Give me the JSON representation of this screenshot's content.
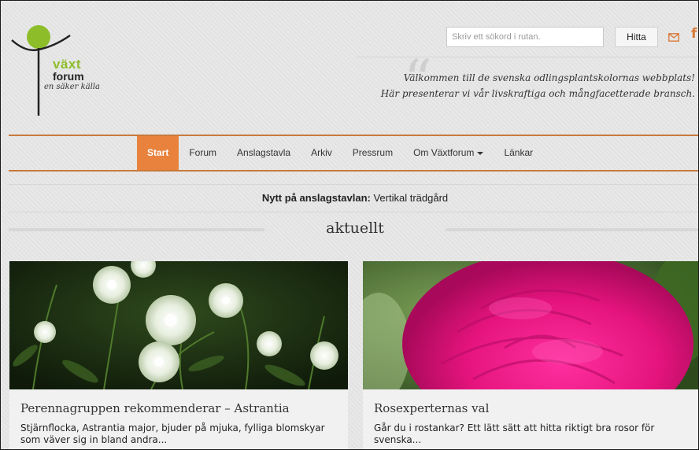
{
  "logo": {
    "word1": "växt",
    "word2": "forum",
    "tagline": "en säker källa"
  },
  "search": {
    "placeholder": "Skriv ett sökord i rutan.",
    "button_label": "Hitta"
  },
  "header": {
    "quote_mark": "“",
    "welcome_line1": "Välkommen till de svenska odlingsplantskolornas webbplats!",
    "welcome_line2": "Här presenterar vi vår livskraftiga och mångfacetterade bransch.",
    "social_facebook": "f"
  },
  "nav": {
    "items": [
      {
        "label": "Start"
      },
      {
        "label": "Forum"
      },
      {
        "label": "Anslagstavla"
      },
      {
        "label": "Arkiv"
      },
      {
        "label": "Pressrum"
      },
      {
        "label": "Om Växtforum"
      },
      {
        "label": "Länkar"
      }
    ]
  },
  "news": {
    "prefix": "Nytt på anslagstavlan:",
    "text": " Vertikal trädgård"
  },
  "section": {
    "title": "aktuellt"
  },
  "cards": [
    {
      "title": "Perennagruppen rekommenderar – Astrantia",
      "excerpt": "Stjärnflocka, Astrantia major, bjuder på mjuka, fylliga blomskyar som väver sig in bland andra..."
    },
    {
      "title": "Rosexperternas val",
      "excerpt": "Går du i rostankar? Ett lätt sätt att hitta riktigt bra rosor för svenska..."
    }
  ],
  "colors": {
    "accent": "#e8823d",
    "nav_line": "#c87a3d",
    "logo_green": "#8dbe2a"
  }
}
